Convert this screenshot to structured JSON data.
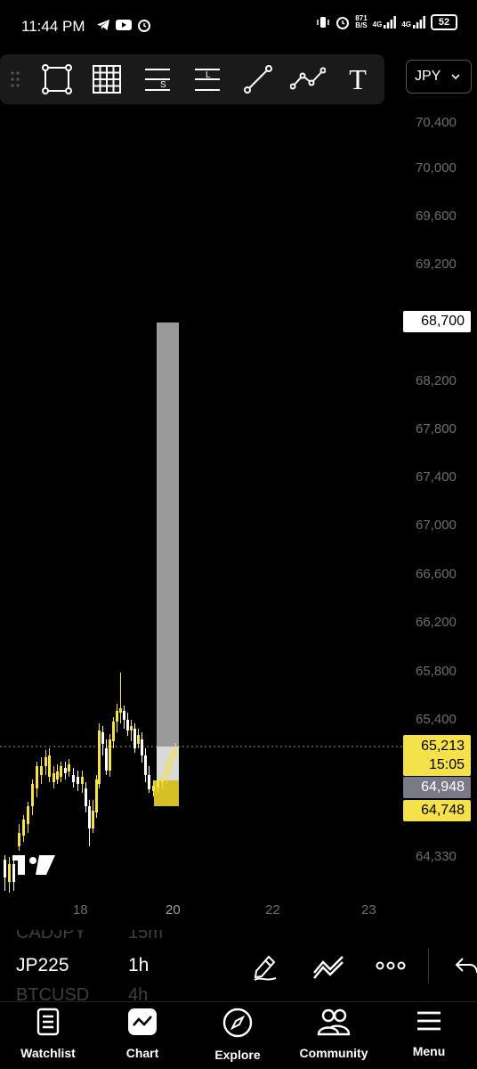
{
  "status_bar": {
    "time": "11:44 PM",
    "net_speed_value": "871",
    "net_speed_unit": "B/S",
    "signal_1": "4G",
    "signal_2": "4G",
    "battery": "52"
  },
  "toolbar": {
    "tools": [
      "rectangle-icon",
      "grid-icon",
      "short-position-icon",
      "long-position-icon",
      "trend-line-icon",
      "path-icon",
      "text-tool-icon"
    ],
    "short_tool_letter": "S",
    "long_tool_letter": "L",
    "text_tool_letter": "T",
    "currency": "JPY"
  },
  "chart": {
    "price_ticks": [
      "70,400",
      "70,000",
      "69,600",
      "69,200",
      "68,200",
      "67,800",
      "67,400",
      "67,000",
      "66,600",
      "66,200",
      "65,800",
      "65,400",
      "64,330"
    ],
    "date_ticks": [
      "18",
      "20",
      "22",
      "23"
    ],
    "target_label": "68,700",
    "last_price": "65,213",
    "countdown": "15:05",
    "entry_label": "64,948",
    "stop_label": "64,748",
    "colors": {
      "up_candle": "#f5e14a",
      "down_candle": "#ffffff",
      "target_zone": "#9a9a9a",
      "stop_zone": "#d4c022",
      "entry_label_bg": "#787b86",
      "background": "#000000"
    }
  },
  "symbols": {
    "prev_symbol": "CADJPY",
    "prev_interval": "15m",
    "current_symbol": "JP225",
    "current_interval": "1h",
    "next_symbol": "BTCUSD",
    "next_interval": "4h"
  },
  "nav": {
    "watchlist": "Watchlist",
    "chart": "Chart",
    "explore": "Explore",
    "community": "Community",
    "menu": "Menu"
  }
}
